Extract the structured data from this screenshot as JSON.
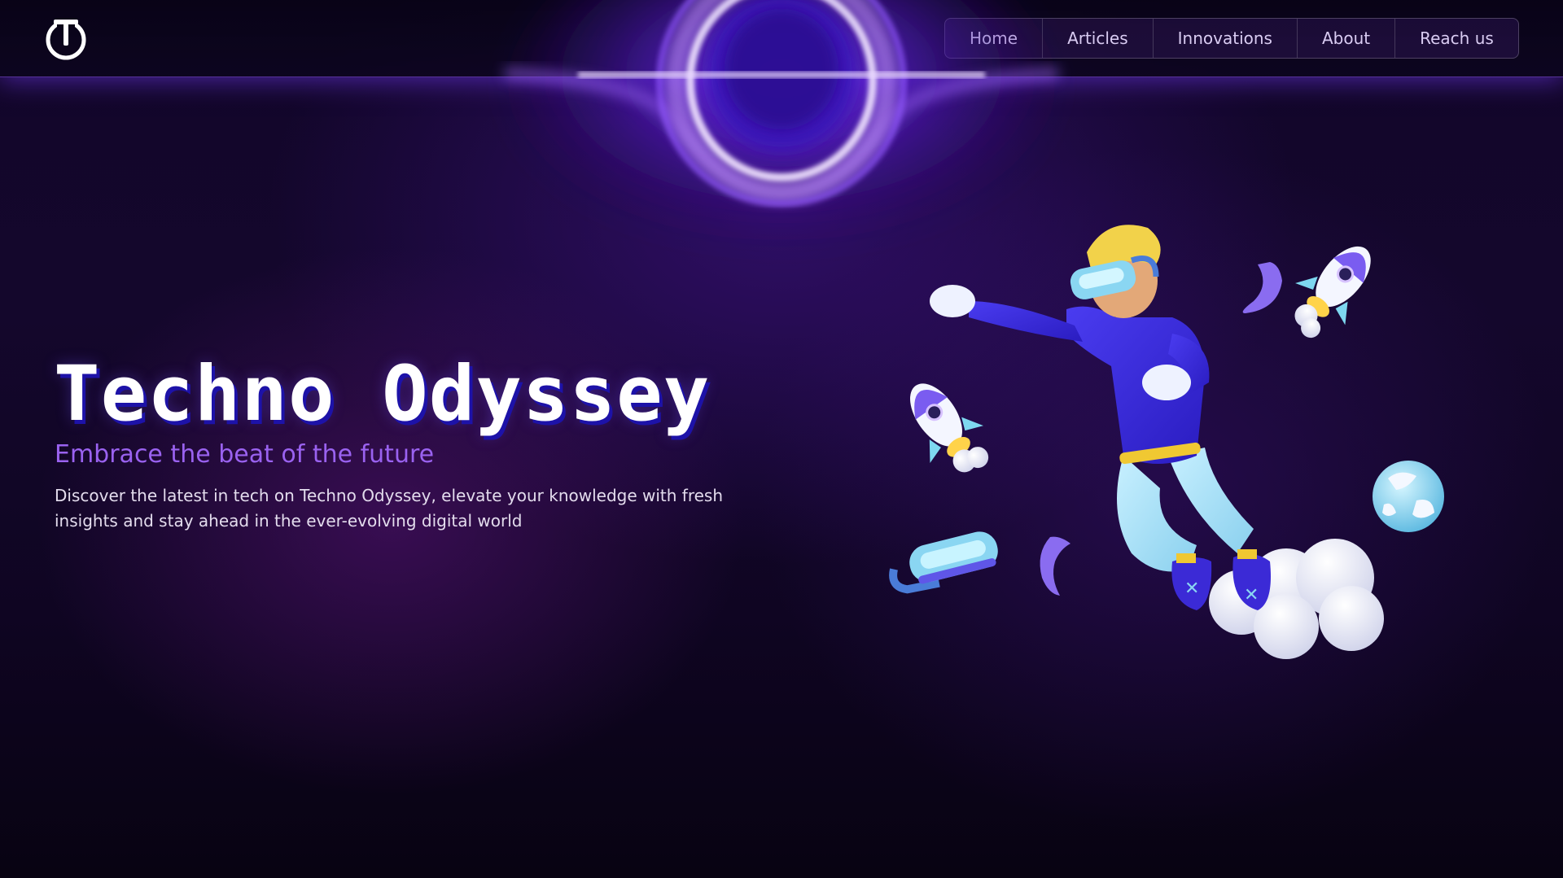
{
  "header": {
    "logo_icon": "power-t-logo-icon",
    "nav": [
      {
        "label": "Home"
      },
      {
        "label": "Articles"
      },
      {
        "label": "Innovations"
      },
      {
        "label": "About"
      },
      {
        "label": "Reach us"
      }
    ]
  },
  "hero": {
    "title": "Techno Odyssey",
    "subtitle": "Embrace the beat of the future",
    "description": "Discover the latest in tech on Techno Odyssey, elevate your knowledge with fresh insights and stay ahead in the ever-evolving digital world",
    "illustration": "vr-astronaut-flying-illustration",
    "decor": [
      "black-hole-portal",
      "rocket-icon",
      "globe-icon",
      "vr-headset-icon",
      "crescent-icon",
      "cloud-icon"
    ]
  },
  "colors": {
    "accent": "#9a62f0",
    "title_shadow": "#1d12a8",
    "background": "#12062a",
    "portal_glow": "#b07cff"
  }
}
